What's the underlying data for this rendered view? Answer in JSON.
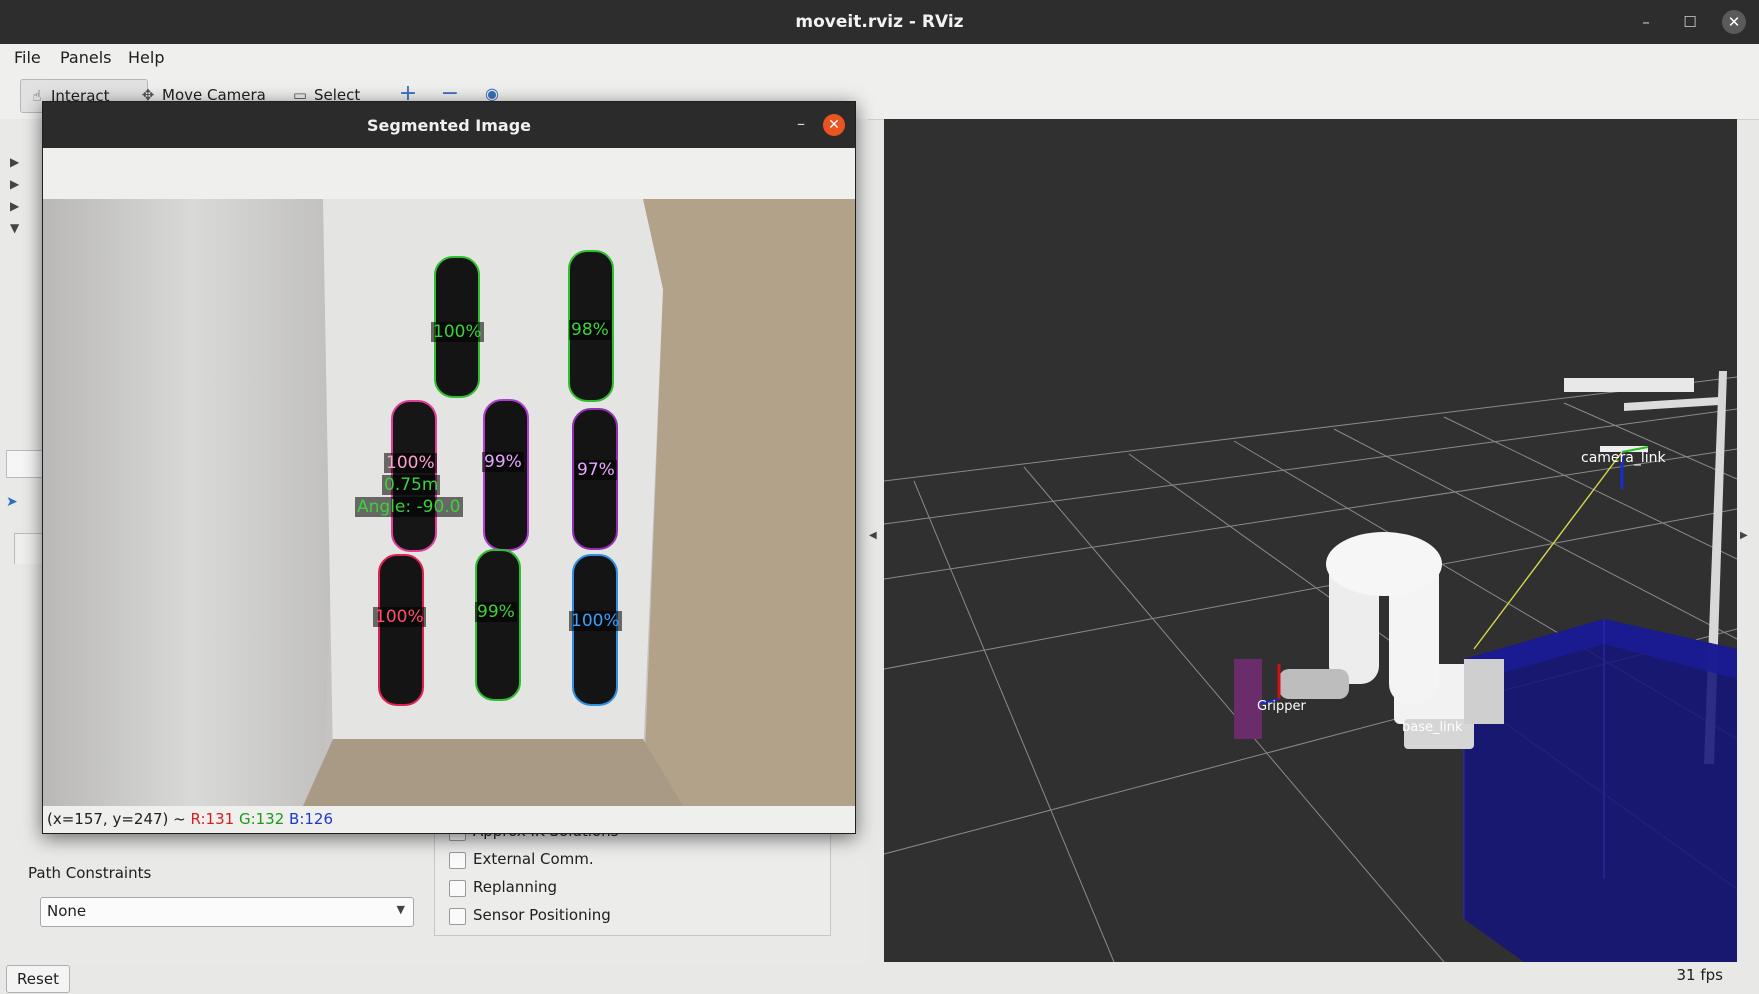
{
  "window": {
    "title": "moveit.rviz - RViz"
  },
  "menu": {
    "file": "File",
    "panels": "Panels",
    "help": "Help"
  },
  "toolbar": {
    "interact": "Interact",
    "move_camera": "Move Camera",
    "select": "Select"
  },
  "panel": {
    "path_constraints_label": "Path Constraints",
    "path_constraints_value": "None",
    "options": [
      {
        "label": "Approx IK Solutions",
        "checked": false
      },
      {
        "label": "External Comm.",
        "checked": false
      },
      {
        "label": "Replanning",
        "checked": false
      },
      {
        "label": "Sensor Positioning",
        "checked": false
      }
    ],
    "reset_label": "Reset"
  },
  "popup": {
    "title": "Segmented Image",
    "status": {
      "coords": "(x=157, y=247) ~",
      "r": "R:131",
      "g": "G:132",
      "b": "B:126"
    },
    "detections": [
      {
        "label": "100%",
        "color": "#3bd23b"
      },
      {
        "label": "98%",
        "color": "#3bd23b"
      },
      {
        "label": "100%",
        "color": "#ff9fd0"
      },
      {
        "label": "0.75m",
        "color": "#3bd23b"
      },
      {
        "label": "Angle: -90.0",
        "color": "#3bd23b"
      },
      {
        "label": "99%",
        "color": "#e7a6ff"
      },
      {
        "label": "97%",
        "color": "#e7a6ff"
      },
      {
        "label": "100%",
        "color": "#ff4d6d"
      },
      {
        "label": "99%",
        "color": "#3bd23b"
      },
      {
        "label": "100%",
        "color": "#3aa0ff"
      }
    ]
  },
  "viewport": {
    "labels": {
      "camera_link": "camera_link",
      "gripper": "Gripper",
      "base_link": "base_link"
    },
    "fps": "31 fps"
  },
  "colors": {
    "titlebar": "#2d2d2d",
    "accent_close": "#e95420",
    "viewport_bg": "#303030",
    "bin": "#14147a"
  }
}
